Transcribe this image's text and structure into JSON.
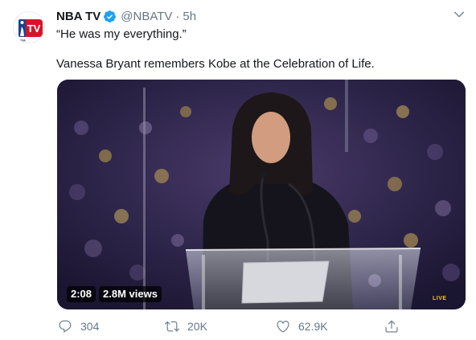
{
  "author": {
    "display_name": "NBA TV",
    "handle": "@NBATV",
    "separator": "·",
    "time": "5h",
    "verified": true,
    "avatar_label": "TV",
    "avatar_sub": "NBA",
    "avatar_colors": {
      "red": "#d5142b",
      "blue": "#1d428a"
    }
  },
  "tweet": {
    "quote": "“He was my everything.”",
    "text": "Vanessa Bryant remembers Kobe at the Celebration of Life."
  },
  "media": {
    "duration": "2:08",
    "views": "2.8M views",
    "live_tag": "LIVE"
  },
  "actions": {
    "replies": "304",
    "retweets": "20K",
    "likes": "62.9K"
  },
  "icons": {
    "reply": "reply-icon",
    "retweet": "retweet-icon",
    "like": "like-icon",
    "share": "share-icon",
    "caret": "chevron-down-icon",
    "verified": "verified-icon"
  },
  "colors": {
    "text": "#14171a",
    "secondary": "#657786",
    "verified": "#1da1f2"
  }
}
